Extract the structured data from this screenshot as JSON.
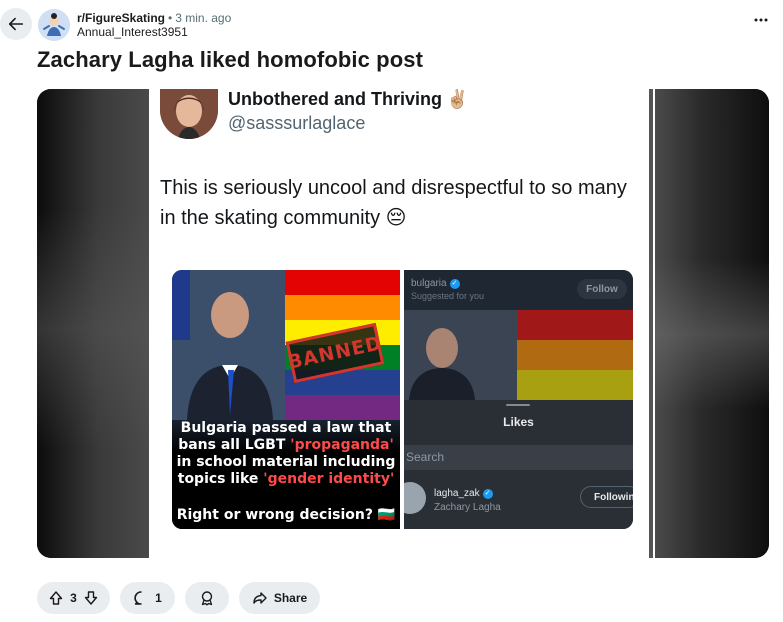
{
  "post": {
    "subreddit": "r/FigureSkating",
    "separator": "•",
    "time_ago": "3 min. ago",
    "author": "Annual_Interest3951",
    "title": "Zachary Lagha liked homofobic post"
  },
  "tweet": {
    "display_name": "Unbothered and Thriving",
    "name_emoji": "✌🏼",
    "handle": "@sasssurlaglace",
    "text": "This is seriously uncool and disrespectful to so many in the skating community 😔",
    "left_image": {
      "stamp": "BANNED",
      "caption_parts": [
        "Bulgaria passed a law that",
        "bans all LGBT ",
        "'propaganda'",
        "in school material including",
        "topics like ",
        "'gender identity'"
      ],
      "question": "Right or wrong decision? 🇧🇬"
    },
    "right_image": {
      "account": "bulgaria",
      "suggested": "Suggested for you",
      "follow_label": "Follow",
      "sheet_title": "Likes",
      "search_placeholder": "Search",
      "user_handle": "lagha_zak",
      "user_name": "Zachary Lagha",
      "user_follow_label": "Following"
    }
  },
  "actions": {
    "vote_count": "3",
    "comment_count": "1",
    "share_label": "Share"
  },
  "icons": {
    "back": "arrow-left-icon",
    "more": "more-horizontal-icon",
    "upvote": "upvote-arrow-icon",
    "downvote": "downvote-arrow-icon",
    "comment": "comment-bubble-icon",
    "award": "award-icon",
    "share": "share-arrow-icon"
  },
  "colors": {
    "pill_bg": "#eaedef",
    "twitter_blue": "#1d9bf0",
    "banned_red": "#d4352c"
  }
}
